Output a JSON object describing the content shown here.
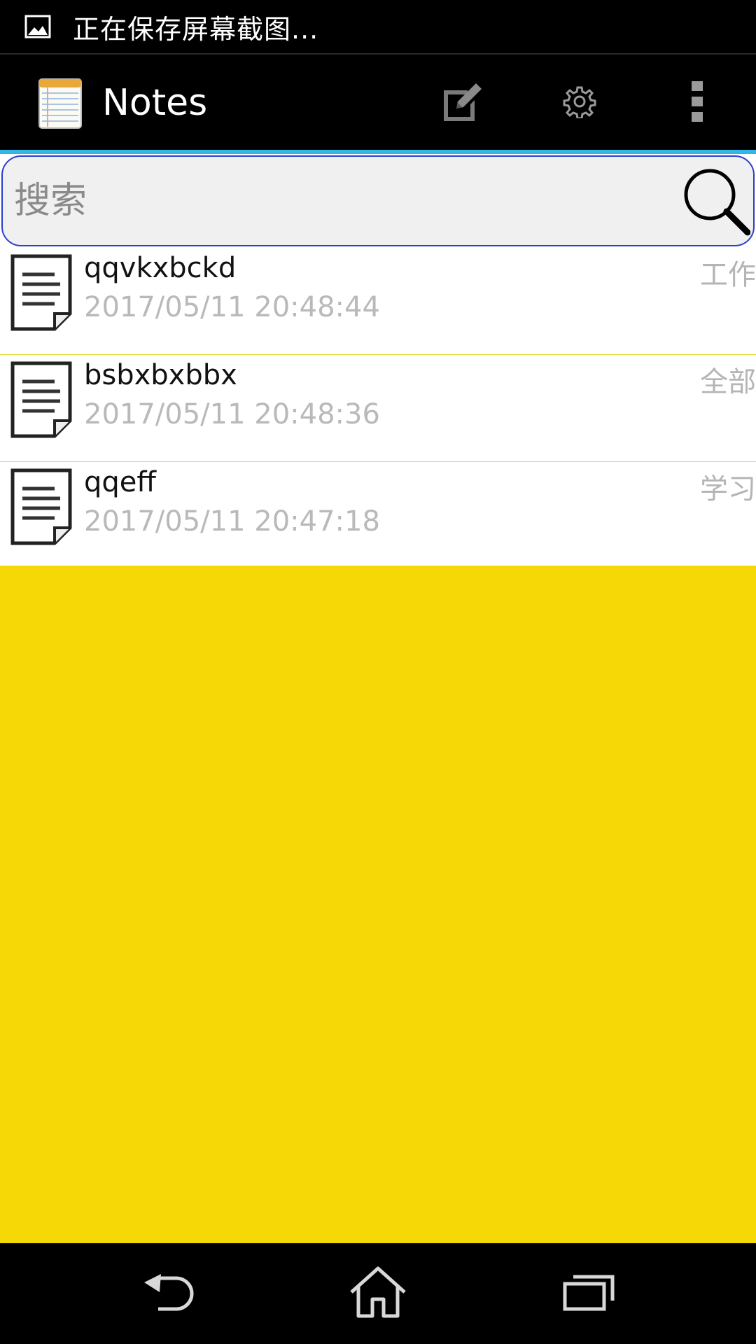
{
  "status_bar": {
    "text": "正在保存屏幕截图..."
  },
  "action_bar": {
    "title": "Notes",
    "icons": [
      "notepad-icon",
      "compose-icon",
      "settings-icon",
      "overflow-menu-icon"
    ]
  },
  "search": {
    "placeholder": "搜索",
    "value": ""
  },
  "notes": [
    {
      "title": "qqvkxbckd",
      "time": "2017/05/11 20:48:44",
      "tag": "工作"
    },
    {
      "title": "bsbxbxbbx",
      "time": "2017/05/11 20:48:36",
      "tag": "全部"
    },
    {
      "title": "qqeff",
      "time": "2017/05/11 20:47:18",
      "tag": "学习"
    }
  ],
  "colors": {
    "background": "#f6d807",
    "accent_line": "#33b5e5",
    "search_border": "#2a3fd0",
    "divider": "#e8df3a"
  },
  "nav_bar": {
    "icons": [
      "back-icon",
      "home-icon",
      "recents-icon"
    ]
  }
}
